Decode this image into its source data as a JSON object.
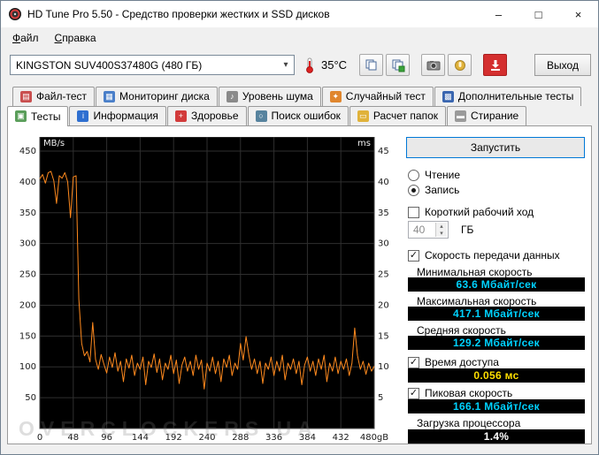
{
  "window": {
    "title": "HD Tune Pro 5.50 - Средство проверки жестких и SSD дисков",
    "controls": {
      "minimize": "–",
      "maximize": "□",
      "close": "×"
    }
  },
  "menu": {
    "items": [
      {
        "name": "menu-file",
        "label": "Файл"
      },
      {
        "name": "menu-help",
        "label": "Справка"
      }
    ]
  },
  "toolbar": {
    "drive": "KINGSTON SUV400S37480G (480 ГБ)",
    "temperature": "35°C",
    "exit_label": "Выход"
  },
  "tabs": {
    "row1": [
      {
        "name": "tab-file-test",
        "label": "Файл-тест",
        "icon_bg": "#c94f4f",
        "glyph": "▤"
      },
      {
        "name": "tab-disk-monitor",
        "label": "Мониторинг диска",
        "icon_bg": "#4a7fc9",
        "glyph": "▦"
      },
      {
        "name": "tab-noise-level",
        "label": "Уровень шума",
        "icon_bg": "#8a8a8a",
        "glyph": "♪"
      },
      {
        "name": "tab-random-test",
        "label": "Случайный тест",
        "icon_bg": "#e0862e",
        "glyph": "✦"
      },
      {
        "name": "tab-extra-tests",
        "label": "Дополнительные тесты",
        "icon_bg": "#3a66b0",
        "glyph": "▩"
      }
    ],
    "row2": [
      {
        "name": "tab-tests",
        "label": "Тесты",
        "icon_bg": "#5a9e5a",
        "glyph": "▣",
        "active": true
      },
      {
        "name": "tab-info",
        "label": "Информация",
        "icon_bg": "#2e6fd0",
        "glyph": "i"
      },
      {
        "name": "tab-health",
        "label": "Здоровье",
        "icon_bg": "#d23b3b",
        "glyph": "+"
      },
      {
        "name": "tab-error-scan",
        "label": "Поиск ошибок",
        "icon_bg": "#57839e",
        "glyph": "○"
      },
      {
        "name": "tab-folder-usage",
        "label": "Расчет папок",
        "icon_bg": "#e0b23a",
        "glyph": "▭"
      },
      {
        "name": "tab-erase",
        "label": "Стирание",
        "icon_bg": "#9a9a9a",
        "glyph": "▬"
      }
    ]
  },
  "chart_data": {
    "type": "line",
    "x_ticks": [
      "0",
      "48",
      "96",
      "144",
      "192",
      "240",
      "288",
      "336",
      "384",
      "432",
      "480gB"
    ],
    "x_max_gb": 480,
    "y_left": {
      "unit": "MB/s",
      "min": 0,
      "max": 450,
      "step": 50
    },
    "y_right": {
      "unit": "ms",
      "min": 0,
      "max": 45,
      "step": 5
    },
    "grid": true,
    "series": [
      {
        "name": "write-speed",
        "unit": "MB/s",
        "color": "#ff8a1e",
        "x_step_gb": 4,
        "values": [
          405,
          412,
          398,
          415,
          417,
          402,
          365,
          410,
          406,
          415,
          400,
          342,
          408,
          410,
          210,
          138,
          118,
          125,
          108,
          172,
          112,
          96,
          120,
          104,
          90,
          116,
          99,
          123,
          93,
          109,
          76,
          113,
          98,
          119,
          86,
          106,
          96,
          116,
          71,
          109,
          99,
          121,
          91,
          113,
          79,
          106,
          96,
          119,
          89,
          111,
          73,
          103,
          116,
          93,
          109,
          86,
          119,
          96,
          111,
          64,
          106,
          93,
          116,
          89,
          109,
          76,
          113,
          99,
          119,
          86,
          106,
          96,
          138,
          111,
          149,
          119,
          96,
          113,
          89,
          109,
          73,
          106,
          96,
          116,
          86,
          109,
          93,
          119,
          79,
          106,
          96,
          113,
          89,
          109,
          71,
          103,
          116,
          93,
          109,
          86,
          113,
          96,
          119,
          76,
          106,
          93,
          116,
          89,
          109,
          96,
          113,
          86,
          106,
          163,
          118,
          96,
          109,
          88,
          106,
          93,
          101
        ]
      }
    ]
  },
  "panel": {
    "run_label": "Запустить",
    "radio_read": "Чтение",
    "radio_write": "Запись",
    "short_stroke": "Короткий рабочий ход",
    "short_stroke_value": "40",
    "short_stroke_unit": "ГБ",
    "transfer": "Скорость передачи данных",
    "min_label": "Минимальная скорость",
    "min_value": "63.6 Мбайт/сек",
    "max_label": "Максимальная скорость",
    "max_value": "417.1 Мбайт/сек",
    "avg_label": "Средняя скорость",
    "avg_value": "129.2 Мбайт/сек",
    "access_label": "Время доступа",
    "access_value": "0.056 мс",
    "burst_label": "Пиковая скорость",
    "burst_value": "166.1 Мбайт/сек",
    "cpu_label": "Загрузка процессора",
    "cpu_value": "1.4%"
  },
  "colors": {
    "speed_value": "#00d2ff",
    "access_value": "#ffdf00",
    "cpu_value": "#ffffff",
    "value_box_bg": "#000000",
    "chart_bg": "#000000",
    "chart_grid": "#2f2f2f",
    "line_color": "#ff8a1e"
  },
  "watermark": "OVERCLOCKERS.UA"
}
